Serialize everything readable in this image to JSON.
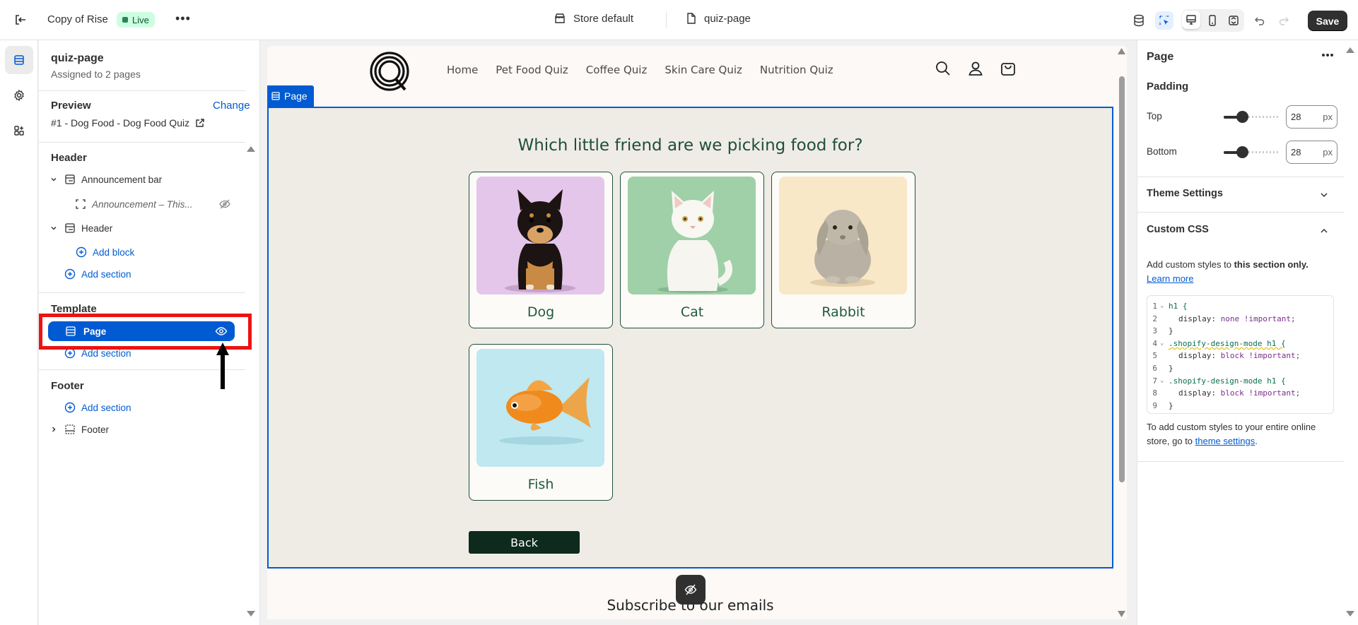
{
  "topbar": {
    "theme_name": "Copy of Rise",
    "status": "Live",
    "more": "•••",
    "store": "Store default",
    "page": "quiz-page",
    "save_label": "Save"
  },
  "sidebar": {
    "title": "quiz-page",
    "subtitle": "Assigned to 2 pages",
    "preview_label": "Preview",
    "change_label": "Change",
    "preview_value": "#1 - Dog Food - Dog Food Quiz",
    "header_group": "Header",
    "announcement_bar": "Announcement bar",
    "announcement_block": "Announcement – This...",
    "header_item": "Header",
    "add_block": "Add block",
    "add_section": "Add section",
    "template_group": "Template",
    "page_item": "Page",
    "footer_group": "Footer",
    "footer_item": "Footer"
  },
  "canvas": {
    "nav": [
      "Home",
      "Pet Food Quiz",
      "Coffee Quiz",
      "Skin Care Quiz",
      "Nutrition Quiz"
    ],
    "selected_tag": "Page",
    "question": "Which little friend are we picking food for?",
    "options": [
      "Dog",
      "Cat",
      "Rabbit",
      "Fish"
    ],
    "back_label": "Back",
    "footer_heading": "Subscribe to our emails"
  },
  "panel": {
    "title": "Page",
    "padding_label": "Padding",
    "top_label": "Top",
    "top_value": "28",
    "bottom_label": "Bottom",
    "bottom_value": "28",
    "unit": "px",
    "theme_settings": "Theme Settings",
    "custom_css": "Custom CSS",
    "desc_prefix": "Add custom styles to ",
    "desc_bold": "this section only.",
    "learn_more": "Learn more",
    "footer_prefix": "To add custom styles to your entire online store, go to ",
    "footer_link": "theme settings",
    "footer_suffix": "."
  },
  "css_code": {
    "l1": "h1 {",
    "l2p": "display:",
    "l2v": "none !important;",
    "l3": "}",
    "l4": ".shopify-design-mode h1 {",
    "l5p": "display:",
    "l5v": "block !important;",
    "l6": "}",
    "l7": ".shopify-design-mode h1 {",
    "l8p": "display:",
    "l8v": "block !important;",
    "l9": "}"
  },
  "colors": {
    "accent": "#005bd3",
    "highlight": "#ec1313",
    "quiz_green": "#1f4f3a"
  }
}
